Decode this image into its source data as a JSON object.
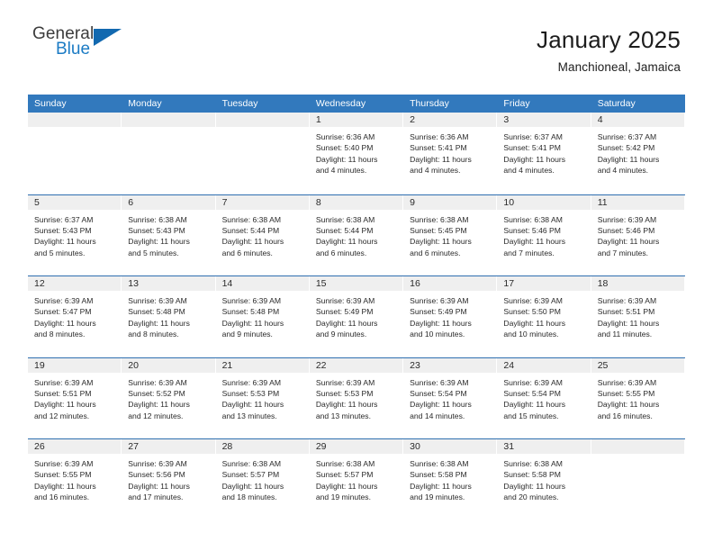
{
  "brand": {
    "logo_line1": "General",
    "logo_line2": "Blue",
    "logo_icon": "triangle-icon",
    "color_dark": "#3c3c3c",
    "color_blue": "#1b7bc4"
  },
  "header": {
    "title": "January 2025",
    "subtitle": "Manchioneal, Jamaica"
  },
  "theme": {
    "header_row_bg": "#3279bd",
    "week_divider": "#2f6fb0",
    "daynum_band_bg": "#efefef",
    "text": "#2a2a2a"
  },
  "calendar": {
    "weekday_headers": [
      "Sunday",
      "Monday",
      "Tuesday",
      "Wednesday",
      "Thursday",
      "Friday",
      "Saturday"
    ],
    "labels": {
      "sunrise": "Sunrise:",
      "sunset": "Sunset:",
      "daylight": "Daylight:"
    },
    "weeks": [
      [
        {
          "day": "",
          "lines": []
        },
        {
          "day": "",
          "lines": []
        },
        {
          "day": "",
          "lines": []
        },
        {
          "day": "1",
          "lines": [
            "Sunrise: 6:36 AM",
            "Sunset: 5:40 PM",
            "Daylight: 11 hours",
            "and 4 minutes."
          ]
        },
        {
          "day": "2",
          "lines": [
            "Sunrise: 6:36 AM",
            "Sunset: 5:41 PM",
            "Daylight: 11 hours",
            "and 4 minutes."
          ]
        },
        {
          "day": "3",
          "lines": [
            "Sunrise: 6:37 AM",
            "Sunset: 5:41 PM",
            "Daylight: 11 hours",
            "and 4 minutes."
          ]
        },
        {
          "day": "4",
          "lines": [
            "Sunrise: 6:37 AM",
            "Sunset: 5:42 PM",
            "Daylight: 11 hours",
            "and 4 minutes."
          ]
        }
      ],
      [
        {
          "day": "5",
          "lines": [
            "Sunrise: 6:37 AM",
            "Sunset: 5:43 PM",
            "Daylight: 11 hours",
            "and 5 minutes."
          ]
        },
        {
          "day": "6",
          "lines": [
            "Sunrise: 6:38 AM",
            "Sunset: 5:43 PM",
            "Daylight: 11 hours",
            "and 5 minutes."
          ]
        },
        {
          "day": "7",
          "lines": [
            "Sunrise: 6:38 AM",
            "Sunset: 5:44 PM",
            "Daylight: 11 hours",
            "and 6 minutes."
          ]
        },
        {
          "day": "8",
          "lines": [
            "Sunrise: 6:38 AM",
            "Sunset: 5:44 PM",
            "Daylight: 11 hours",
            "and 6 minutes."
          ]
        },
        {
          "day": "9",
          "lines": [
            "Sunrise: 6:38 AM",
            "Sunset: 5:45 PM",
            "Daylight: 11 hours",
            "and 6 minutes."
          ]
        },
        {
          "day": "10",
          "lines": [
            "Sunrise: 6:38 AM",
            "Sunset: 5:46 PM",
            "Daylight: 11 hours",
            "and 7 minutes."
          ]
        },
        {
          "day": "11",
          "lines": [
            "Sunrise: 6:39 AM",
            "Sunset: 5:46 PM",
            "Daylight: 11 hours",
            "and 7 minutes."
          ]
        }
      ],
      [
        {
          "day": "12",
          "lines": [
            "Sunrise: 6:39 AM",
            "Sunset: 5:47 PM",
            "Daylight: 11 hours",
            "and 8 minutes."
          ]
        },
        {
          "day": "13",
          "lines": [
            "Sunrise: 6:39 AM",
            "Sunset: 5:48 PM",
            "Daylight: 11 hours",
            "and 8 minutes."
          ]
        },
        {
          "day": "14",
          "lines": [
            "Sunrise: 6:39 AM",
            "Sunset: 5:48 PM",
            "Daylight: 11 hours",
            "and 9 minutes."
          ]
        },
        {
          "day": "15",
          "lines": [
            "Sunrise: 6:39 AM",
            "Sunset: 5:49 PM",
            "Daylight: 11 hours",
            "and 9 minutes."
          ]
        },
        {
          "day": "16",
          "lines": [
            "Sunrise: 6:39 AM",
            "Sunset: 5:49 PM",
            "Daylight: 11 hours",
            "and 10 minutes."
          ]
        },
        {
          "day": "17",
          "lines": [
            "Sunrise: 6:39 AM",
            "Sunset: 5:50 PM",
            "Daylight: 11 hours",
            "and 10 minutes."
          ]
        },
        {
          "day": "18",
          "lines": [
            "Sunrise: 6:39 AM",
            "Sunset: 5:51 PM",
            "Daylight: 11 hours",
            "and 11 minutes."
          ]
        }
      ],
      [
        {
          "day": "19",
          "lines": [
            "Sunrise: 6:39 AM",
            "Sunset: 5:51 PM",
            "Daylight: 11 hours",
            "and 12 minutes."
          ]
        },
        {
          "day": "20",
          "lines": [
            "Sunrise: 6:39 AM",
            "Sunset: 5:52 PM",
            "Daylight: 11 hours",
            "and 12 minutes."
          ]
        },
        {
          "day": "21",
          "lines": [
            "Sunrise: 6:39 AM",
            "Sunset: 5:53 PM",
            "Daylight: 11 hours",
            "and 13 minutes."
          ]
        },
        {
          "day": "22",
          "lines": [
            "Sunrise: 6:39 AM",
            "Sunset: 5:53 PM",
            "Daylight: 11 hours",
            "and 13 minutes."
          ]
        },
        {
          "day": "23",
          "lines": [
            "Sunrise: 6:39 AM",
            "Sunset: 5:54 PM",
            "Daylight: 11 hours",
            "and 14 minutes."
          ]
        },
        {
          "day": "24",
          "lines": [
            "Sunrise: 6:39 AM",
            "Sunset: 5:54 PM",
            "Daylight: 11 hours",
            "and 15 minutes."
          ]
        },
        {
          "day": "25",
          "lines": [
            "Sunrise: 6:39 AM",
            "Sunset: 5:55 PM",
            "Daylight: 11 hours",
            "and 16 minutes."
          ]
        }
      ],
      [
        {
          "day": "26",
          "lines": [
            "Sunrise: 6:39 AM",
            "Sunset: 5:55 PM",
            "Daylight: 11 hours",
            "and 16 minutes."
          ]
        },
        {
          "day": "27",
          "lines": [
            "Sunrise: 6:39 AM",
            "Sunset: 5:56 PM",
            "Daylight: 11 hours",
            "and 17 minutes."
          ]
        },
        {
          "day": "28",
          "lines": [
            "Sunrise: 6:38 AM",
            "Sunset: 5:57 PM",
            "Daylight: 11 hours",
            "and 18 minutes."
          ]
        },
        {
          "day": "29",
          "lines": [
            "Sunrise: 6:38 AM",
            "Sunset: 5:57 PM",
            "Daylight: 11 hours",
            "and 19 minutes."
          ]
        },
        {
          "day": "30",
          "lines": [
            "Sunrise: 6:38 AM",
            "Sunset: 5:58 PM",
            "Daylight: 11 hours",
            "and 19 minutes."
          ]
        },
        {
          "day": "31",
          "lines": [
            "Sunrise: 6:38 AM",
            "Sunset: 5:58 PM",
            "Daylight: 11 hours",
            "and 20 minutes."
          ]
        },
        {
          "day": "",
          "lines": []
        }
      ]
    ]
  }
}
